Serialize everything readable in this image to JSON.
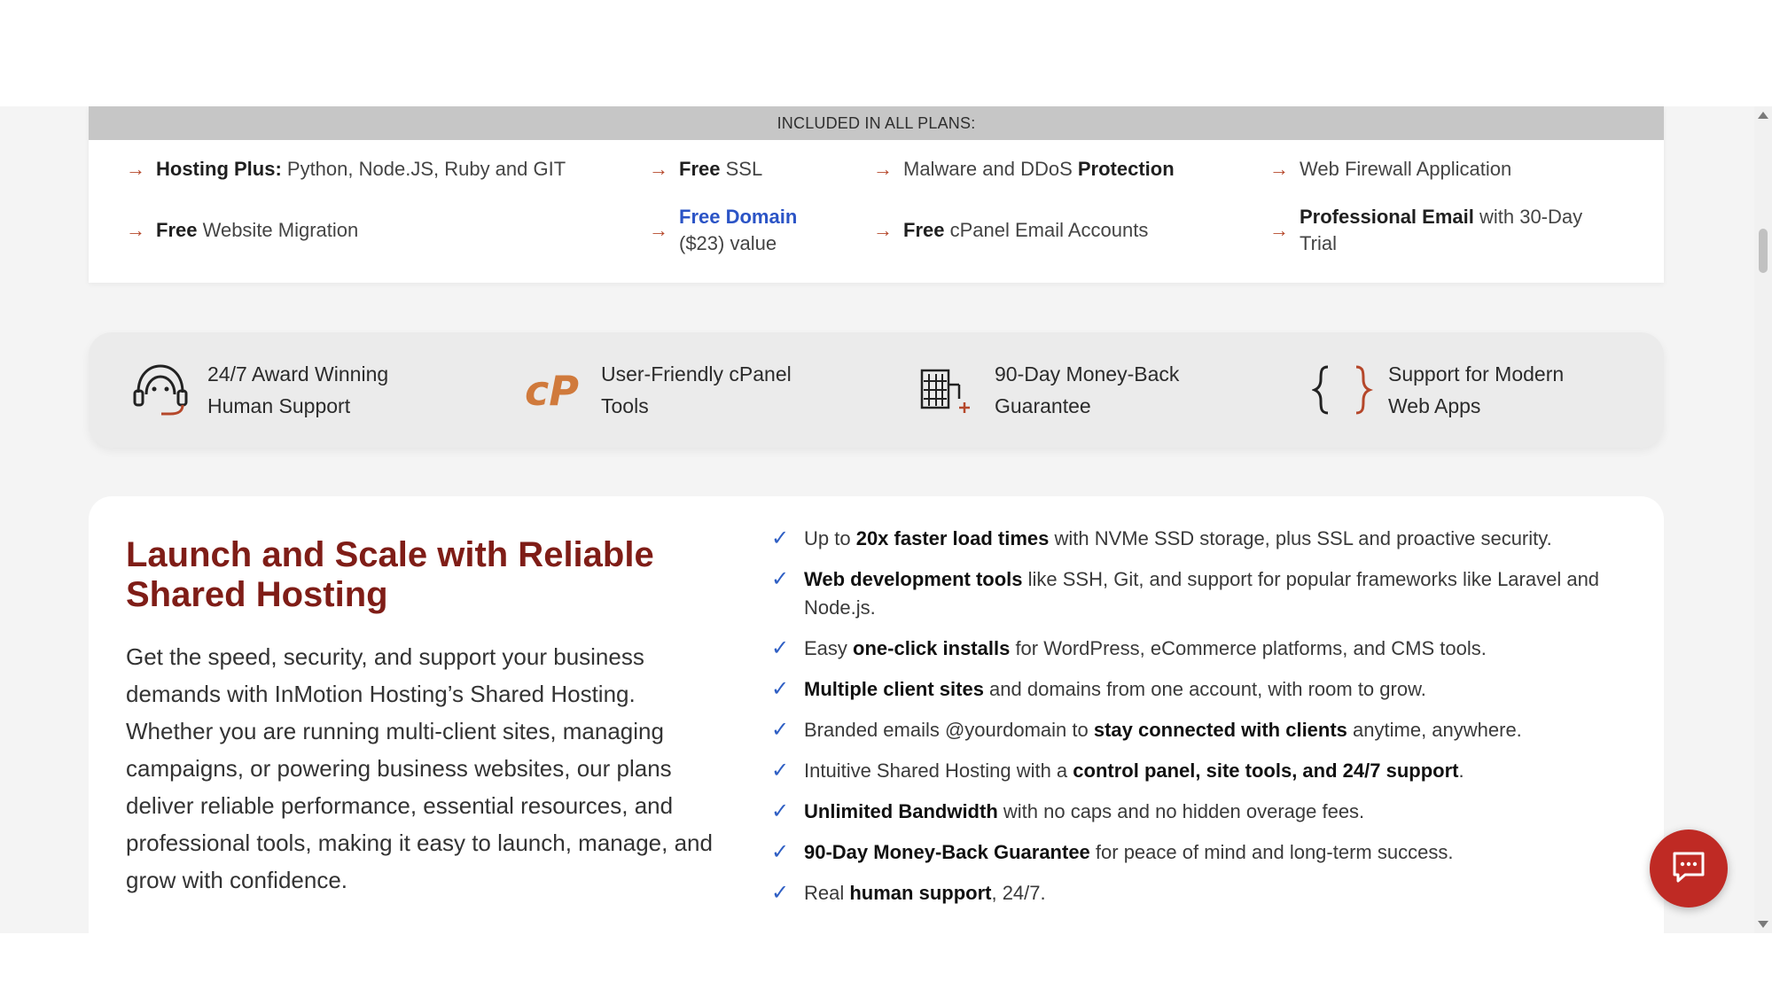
{
  "plans": {
    "header": "INCLUDED IN ALL PLANS:",
    "features": [
      {
        "bold": "Hosting Plus:",
        "text": " Python, Node.JS, Ruby and GIT"
      },
      {
        "bold": "Free",
        "text": " SSL"
      },
      {
        "pre": "Malware and DDoS ",
        "bold": "Protection"
      },
      {
        "text": "Web Firewall Application"
      },
      {
        "bold": "Free",
        "text": " Website Migration"
      },
      {
        "link": "Free Domain",
        "line2": "($23) value"
      },
      {
        "bold": "Free",
        "text": " cPanel Email Accounts"
      },
      {
        "bold": "Professional Email",
        "text": " with 30-Day",
        "line2": "Trial"
      }
    ]
  },
  "highlights": [
    {
      "icon": "headset-icon",
      "line1": "24/7 Award Winning",
      "line2": "Human Support"
    },
    {
      "icon": "cpanel-logo-icon",
      "line1": "User-Friendly cPanel",
      "line2": "Tools"
    },
    {
      "icon": "building-icon",
      "line1": "90-Day Money-Back",
      "line2": "Guarantee"
    },
    {
      "icon": "curly-braces-icon",
      "line1": "Support for Modern",
      "line2": "Web Apps"
    }
  ],
  "main": {
    "title": "Launch and Scale with Reliable Shared Hosting",
    "description": "Get the speed, security, and support your business demands with InMotion Hosting’s Shared Hosting. Whether you are running multi-client sites, managing campaigns, or powering business websites, our plans deliver reliable performance, essential resources, and professional tools, making it easy to launch, manage, and grow with confidence.",
    "checklist": [
      {
        "pre": "Up to ",
        "bold": "20x faster load times",
        "post": " with NVMe SSD storage, plus SSL and proactive security."
      },
      {
        "pre": "",
        "bold": "Web development tools",
        "post": " like SSH, Git, and support for popular frameworks like Laravel and Node.js."
      },
      {
        "pre": "Easy ",
        "bold": "one-click installs",
        "post": " for WordPress, eCommerce platforms, and CMS tools."
      },
      {
        "pre": "",
        "bold": "Multiple client sites",
        "post": " and domains from one account, with room to grow."
      },
      {
        "pre": "Branded emails @yourdomain to ",
        "bold": "stay connected with clients",
        "post": " anytime, anywhere."
      },
      {
        "pre": "Intuitive Shared Hosting with a ",
        "bold": "control panel, site tools, and 24/7 support",
        "post": "."
      },
      {
        "pre": "",
        "bold": "Unlimited Bandwidth",
        "post": " with no caps and no hidden overage fees."
      },
      {
        "pre": "",
        "bold": "90-Day Money-Back Guarantee",
        "post": " for peace of mind and long-term success."
      },
      {
        "pre": "Real ",
        "bold": "human support",
        "post": ", 24/7."
      }
    ]
  },
  "colors": {
    "accent": "#b5472a",
    "title": "#7f1d17",
    "link": "#2b54c6",
    "check": "#2f5fc4",
    "chat": "#bf2a24"
  }
}
